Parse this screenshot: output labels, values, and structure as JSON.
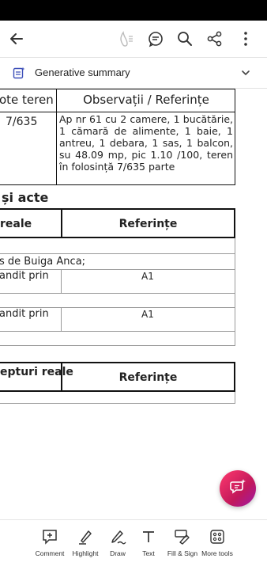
{
  "appbar": {
    "icons": [
      "back-arrow-icon",
      "read-aloud-icon",
      "comments-icon",
      "search-icon",
      "share-icon",
      "more-vertical-icon"
    ]
  },
  "generative_summary": {
    "label": "Generative summary",
    "icon": "ai-summary-icon",
    "chevron": "chevron-down-icon"
  },
  "document": {
    "table1": {
      "header_col1": "ote teren",
      "header_col2": "Observații / Referințe",
      "cell_col1": "7/635",
      "cell_col2": "Ap nr 61 cu 2 camere, 1 bucătărie, 1 cămară de alimente, 1 baie, 1 antreu, 1 debara, 1 sas, 1 balcon, su 48.09 mp, pic 1.10 /100, teren în folosință 7/635 parte"
    },
    "section_title": "și acte",
    "table2": {
      "header_col1": "reale",
      "header_col2": "Referințe"
    },
    "rows": [
      {
        "text": "s de Buiga Anca;",
        "ref": ""
      },
      {
        "text": "andit prin",
        "ref": "A1"
      },
      {
        "text": "andit prin",
        "ref": "A1"
      }
    ],
    "table3": {
      "header_col1": "epturi reale",
      "header_col2": "Referințe"
    }
  },
  "fab": {
    "icon": "ai-assistant-icon"
  },
  "toolbar": {
    "items": [
      {
        "label": "Comment",
        "icon": "comment-add-icon"
      },
      {
        "label": "Highlight",
        "icon": "highlight-pen-icon"
      },
      {
        "label": "Draw",
        "icon": "draw-pen-icon"
      },
      {
        "label": "Text",
        "icon": "text-tool-icon"
      },
      {
        "label": "Fill & Sign",
        "icon": "fill-sign-icon"
      },
      {
        "label": "More tools",
        "icon": "more-tools-icon"
      }
    ]
  },
  "colors": {
    "fab_gradient_start": "#ff3a6e",
    "fab_gradient_end": "#9c1aa8",
    "text": "#222222",
    "background": "#ffffff"
  }
}
